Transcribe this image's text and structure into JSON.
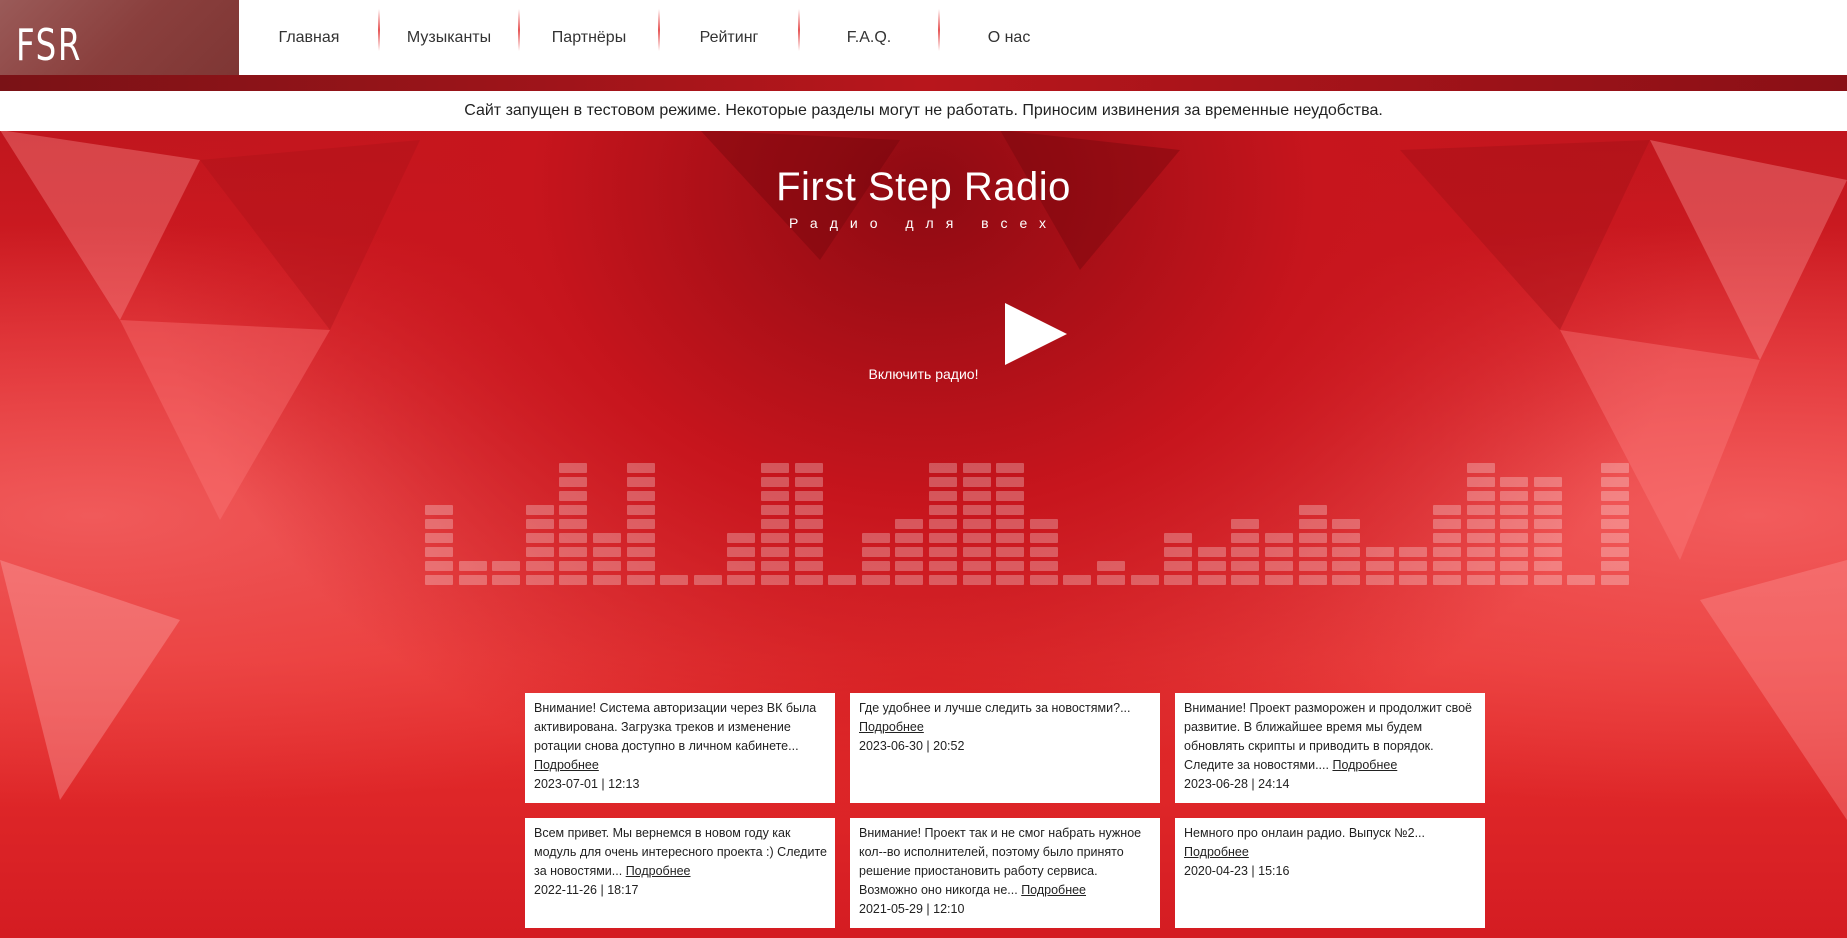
{
  "logo": "FSR",
  "nav": [
    "Главная",
    "Музыканты",
    "Партнёры",
    "Рейтинг",
    "F.A.Q.",
    "О нас"
  ],
  "notice": "Сайт запущен в тестовом режиме. Некоторые разделы могут не работать. Приносим извинения за временные неудобства.",
  "hero": {
    "title": "First Step Radio",
    "subtitle": "Радио для всех",
    "play_label": "Включить радио!"
  },
  "equalizer_levels": [
    6,
    2,
    2,
    6,
    9,
    4,
    9,
    1,
    1,
    4,
    9,
    9,
    1,
    4,
    5,
    9,
    9,
    9,
    5,
    1,
    2,
    1,
    4,
    3,
    5,
    4,
    6,
    5,
    3,
    3,
    6,
    9,
    8,
    8,
    1,
    9
  ],
  "news": [
    {
      "text": "Внимание! Система авторизации через ВК была активирована. Загрузка треков и изменение ротации снова доступно в личном кабинете...",
      "more": "Подробнее",
      "date": "2023-07-01 | 12:13"
    },
    {
      "text": "Где удобнее и лучше следить за новостями?...",
      "more": "Подробнее",
      "date": "2023-06-30 | 20:52"
    },
    {
      "text": "Внимание! Проект разморожен и продолжит своё развитие. В ближайшее время мы будем обновлять скрипты и приводить в порядок. Следите за новостями....",
      "more": "Подробнее",
      "date": "2023-06-28 | 24:14"
    },
    {
      "text": "Всем привет. Мы вернемся в новом году как модуль для очень интересного проекта :) Следите за новостями...",
      "more": "Подробнее",
      "date": "2022-11-26 | 18:17"
    },
    {
      "text": "Внимание! Проект так и не смог набрать нужное кол--во исполнителей, поэтому было принято решение приостановить работу сервиса. Возможно оно никогда не...",
      "more": "Подробнее",
      "date": "2021-05-29 | 12:10"
    },
    {
      "text": "Немного про онлаин радио. Выпуск №2...",
      "more": "Подробнее",
      "date": "2020-04-23 | 15:16"
    }
  ]
}
